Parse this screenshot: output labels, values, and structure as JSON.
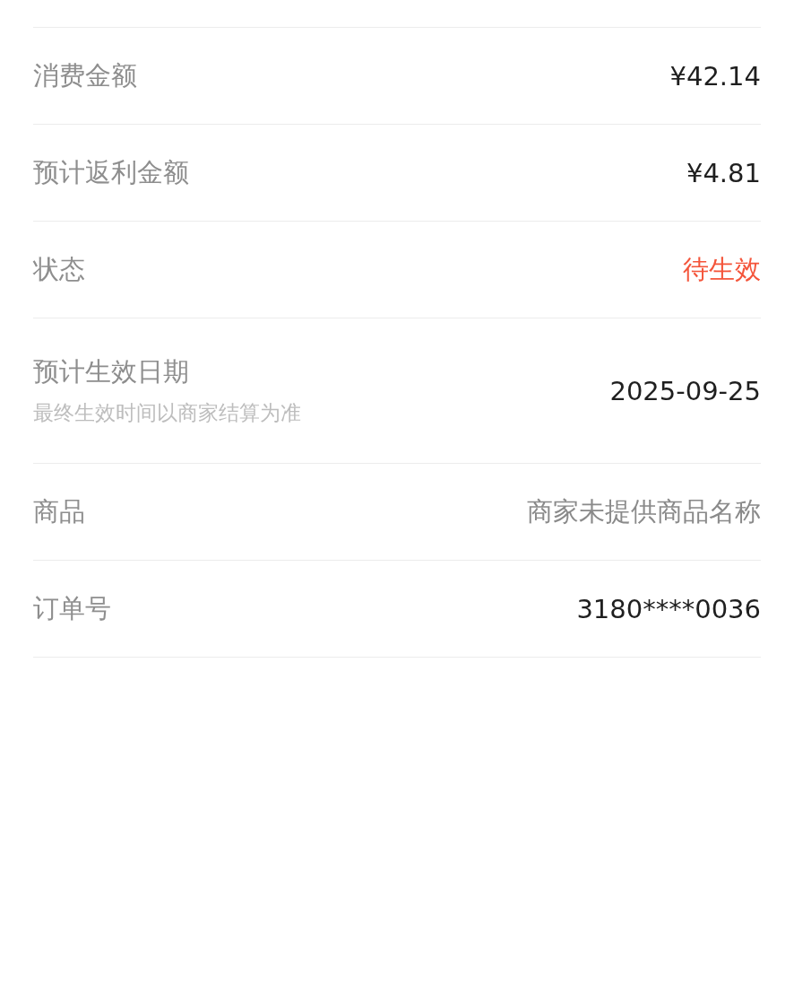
{
  "rows": [
    {
      "label": "消费金额",
      "value": "¥42.14",
      "kind": "plain"
    },
    {
      "label": "预计返利金额",
      "value": "¥4.81",
      "kind": "plain"
    },
    {
      "label": "状态",
      "value": "待生效",
      "kind": "status"
    },
    {
      "label": "预计生效日期",
      "note": "最终生效时间以商家结算为准",
      "value": "2025-09-25",
      "kind": "plain"
    },
    {
      "label": "商品",
      "value": "商家未提供商品名称",
      "kind": "muted"
    },
    {
      "label": "订单号",
      "value": "3180****0036",
      "kind": "plain"
    }
  ]
}
